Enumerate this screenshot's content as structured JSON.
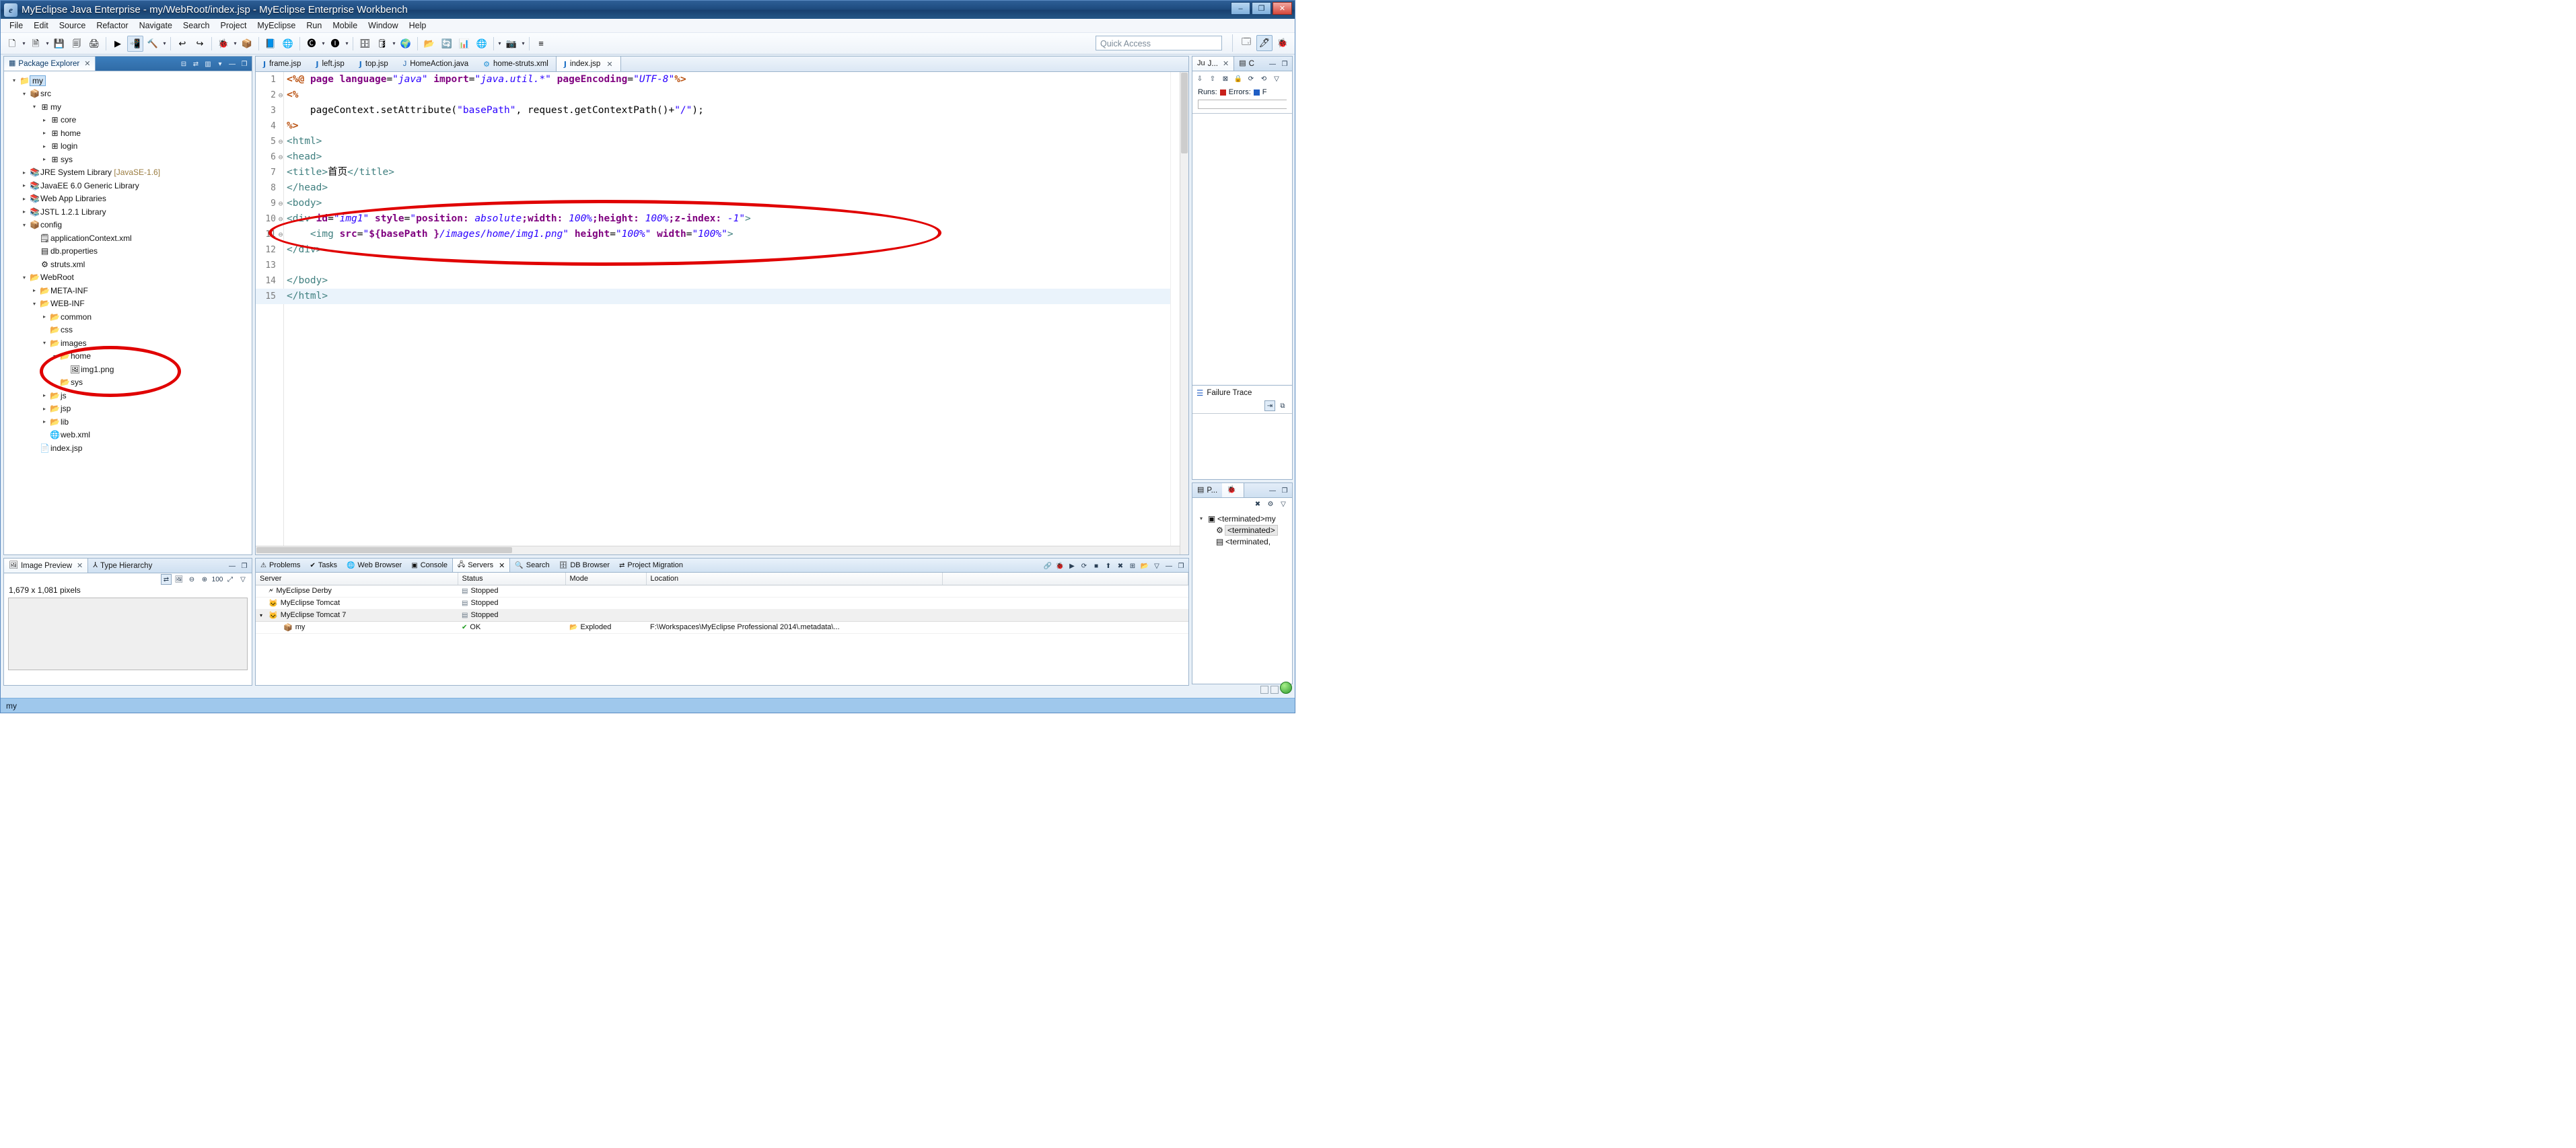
{
  "window": {
    "title": "MyEclipse Java Enterprise - my/WebRoot/index.jsp - MyEclipse Enterprise Workbench",
    "app_icon": "myeclipse-icon",
    "minimize": "–",
    "maximize": "❐",
    "close": "✕"
  },
  "menubar": [
    {
      "label": "File"
    },
    {
      "label": "Edit"
    },
    {
      "label": "Source"
    },
    {
      "label": "Refactor"
    },
    {
      "label": "Navigate"
    },
    {
      "label": "Search"
    },
    {
      "label": "Project"
    },
    {
      "label": "MyEclipse"
    },
    {
      "label": "Run"
    },
    {
      "label": "Mobile"
    },
    {
      "label": "Window"
    },
    {
      "label": "Help"
    }
  ],
  "toolbar": {
    "quick_access_placeholder": "Quick Access",
    "items": [
      {
        "name": "new-wizard",
        "glyph": "🗋"
      },
      {
        "name": "dropdown-arrow",
        "glyph": "▾"
      },
      {
        "name": "new-java-project",
        "glyph": "🗎"
      },
      {
        "name": "dropdown-arrow",
        "glyph": "▾"
      },
      {
        "name": "save",
        "glyph": "💾"
      },
      {
        "name": "save-all",
        "glyph": "🗐"
      },
      {
        "name": "print",
        "glyph": "🖨"
      },
      {
        "name": "run-server",
        "glyph": "▶"
      },
      {
        "name": "deploy-myeclipse",
        "glyph": "📲"
      },
      {
        "name": "build",
        "glyph": "🔨"
      },
      {
        "name": "dropdown-arrow",
        "glyph": "▾"
      },
      {
        "name": "undo",
        "glyph": "↩"
      },
      {
        "name": "redo",
        "glyph": "↪"
      },
      {
        "name": "debug",
        "glyph": "🐞"
      },
      {
        "name": "dropdown-arrow",
        "glyph": "▾"
      },
      {
        "name": "open-type",
        "glyph": "📦"
      },
      {
        "name": "open-resource",
        "glyph": "📘"
      },
      {
        "name": "web-20",
        "glyph": "🌐"
      },
      {
        "name": "new-class",
        "glyph": "🅒"
      },
      {
        "name": "dropdown-arrow",
        "glyph": "▾"
      },
      {
        "name": "new-interface",
        "glyph": "🅘"
      },
      {
        "name": "dropdown-arrow",
        "glyph": "▾"
      },
      {
        "name": "db-explorer",
        "glyph": "🗄"
      },
      {
        "name": "run-db",
        "glyph": "🛢"
      },
      {
        "name": "dropdown-arrow",
        "glyph": "▾"
      },
      {
        "name": "globe",
        "glyph": "🌍"
      },
      {
        "name": "open-folder",
        "glyph": "📂"
      },
      {
        "name": "refresh",
        "glyph": "🔄"
      },
      {
        "name": "report",
        "glyph": "📊"
      },
      {
        "name": "web-browser",
        "glyph": "🌐"
      },
      {
        "name": "dropdown-arrow",
        "glyph": "▾"
      },
      {
        "name": "snapshot",
        "glyph": "📷"
      },
      {
        "name": "dropdown-arrow",
        "glyph": "▾"
      },
      {
        "name": "toggle-marks",
        "glyph": "≡"
      }
    ],
    "perspective": [
      {
        "name": "open-perspective",
        "glyph": "🗔",
        "active": false
      },
      {
        "name": "myeclipse-java-enterprise-perspective",
        "glyph": "🖊",
        "active": true
      },
      {
        "name": "debug-perspective",
        "glyph": "🐞",
        "active": false
      }
    ]
  },
  "package_explorer": {
    "tabs": [
      {
        "label": "Package Explorer",
        "icon": "package-explorer-icon",
        "active": true,
        "closable": true
      }
    ],
    "toolbar": [
      {
        "name": "collapse-all-icon",
        "glyph": "⊟"
      },
      {
        "name": "link-with-editor-icon",
        "glyph": "⇄"
      },
      {
        "name": "view-menu-filter-icon",
        "glyph": "▥"
      },
      {
        "name": "view-menu-icon",
        "glyph": "▾"
      },
      {
        "name": "minimize-icon",
        "glyph": "—"
      },
      {
        "name": "maximize-icon",
        "glyph": "❐"
      }
    ],
    "tree": [
      {
        "indent": 0,
        "twisty": "▾",
        "icon": "project-icon",
        "glyph": "📁",
        "label": "my",
        "selected": true
      },
      {
        "indent": 1,
        "twisty": "▾",
        "icon": "source-folder-icon",
        "glyph": "📦",
        "label": "src"
      },
      {
        "indent": 2,
        "twisty": "▾",
        "icon": "package-icon",
        "glyph": "⊞",
        "label": "my"
      },
      {
        "indent": 3,
        "twisty": "▸",
        "icon": "package-error-icon",
        "glyph": "⊞",
        "label": "core"
      },
      {
        "indent": 3,
        "twisty": "▸",
        "icon": "package-warning-icon",
        "glyph": "⊞",
        "label": "home"
      },
      {
        "indent": 3,
        "twisty": "▸",
        "icon": "package-warning-icon",
        "glyph": "⊞",
        "label": "login"
      },
      {
        "indent": 3,
        "twisty": "▸",
        "icon": "package-warning-icon",
        "glyph": "⊞",
        "label": "sys"
      },
      {
        "indent": 1,
        "twisty": "▸",
        "icon": "library-icon",
        "glyph": "📚",
        "label": "JRE System Library",
        "dim": " [JavaSE-1.6]"
      },
      {
        "indent": 1,
        "twisty": "▸",
        "icon": "library-icon",
        "glyph": "📚",
        "label": "JavaEE 6.0 Generic Library"
      },
      {
        "indent": 1,
        "twisty": "▸",
        "icon": "library-icon",
        "glyph": "📚",
        "label": "Web App Libraries"
      },
      {
        "indent": 1,
        "twisty": "▸",
        "icon": "library-icon",
        "glyph": "📚",
        "label": "JSTL 1.2.1 Library"
      },
      {
        "indent": 1,
        "twisty": "▾",
        "icon": "source-folder-icon",
        "glyph": "📦",
        "label": "config"
      },
      {
        "indent": 2,
        "twisty": "",
        "icon": "xml-file-icon",
        "glyph": "🗒",
        "label": "applicationContext.xml"
      },
      {
        "indent": 2,
        "twisty": "",
        "icon": "properties-file-icon",
        "glyph": "▤",
        "label": "db.properties"
      },
      {
        "indent": 2,
        "twisty": "",
        "icon": "struts-config-icon",
        "glyph": "⚙",
        "label": "struts.xml"
      },
      {
        "indent": 1,
        "twisty": "▾",
        "icon": "webroot-folder-icon",
        "glyph": "📂",
        "label": "WebRoot"
      },
      {
        "indent": 2,
        "twisty": "▸",
        "icon": "folder-icon",
        "glyph": "📂",
        "label": "META-INF"
      },
      {
        "indent": 2,
        "twisty": "▾",
        "icon": "folder-warning-icon",
        "glyph": "📂",
        "label": "WEB-INF"
      },
      {
        "indent": 3,
        "twisty": "▸",
        "icon": "folder-icon",
        "glyph": "📂",
        "label": "common"
      },
      {
        "indent": 3,
        "twisty": "",
        "icon": "folder-icon",
        "glyph": "📂",
        "label": "css"
      },
      {
        "indent": 3,
        "twisty": "▾",
        "icon": "folder-icon",
        "glyph": "📂",
        "label": "images"
      },
      {
        "indent": 4,
        "twisty": "▾",
        "icon": "folder-icon",
        "glyph": "📂",
        "label": "home"
      },
      {
        "indent": 5,
        "twisty": "",
        "icon": "image-file-icon",
        "glyph": "🖼",
        "label": "img1.png"
      },
      {
        "indent": 4,
        "twisty": "",
        "icon": "folder-icon",
        "glyph": "📂",
        "label": "sys"
      },
      {
        "indent": 3,
        "twisty": "▸",
        "icon": "folder-warning-icon",
        "glyph": "📂",
        "label": "js"
      },
      {
        "indent": 3,
        "twisty": "▸",
        "icon": "folder-warning-icon",
        "glyph": "📂",
        "label": "jsp"
      },
      {
        "indent": 3,
        "twisty": "▸",
        "icon": "folder-icon",
        "glyph": "📂",
        "label": "lib"
      },
      {
        "indent": 3,
        "twisty": "",
        "icon": "web-xml-icon",
        "glyph": "🌐",
        "label": "web.xml"
      },
      {
        "indent": 2,
        "twisty": "",
        "icon": "jsp-file-icon",
        "glyph": "📄",
        "label": "index.jsp"
      }
    ]
  },
  "image_preview": {
    "tabs": [
      {
        "label": "Image Preview",
        "icon": "image-preview-icon",
        "active": true,
        "closable": true
      },
      {
        "label": "Type Hierarchy",
        "icon": "type-hierarchy-icon",
        "active": false,
        "closable": false
      }
    ],
    "view_buttons": [
      {
        "name": "minimize-icon",
        "glyph": "—"
      },
      {
        "name": "maximize-icon",
        "glyph": "❐"
      }
    ],
    "toolbar": [
      {
        "name": "link-with-editor-icon",
        "glyph": "⇄",
        "framed": true
      },
      {
        "name": "image-properties-icon",
        "glyph": "🖼"
      },
      {
        "name": "zoom-out-icon",
        "glyph": "⊖"
      },
      {
        "name": "zoom-in-icon",
        "glyph": "⊕"
      },
      {
        "name": "zoom-100-icon",
        "glyph": "100"
      },
      {
        "name": "fit-to-window-icon",
        "glyph": "⤢"
      },
      {
        "name": "view-menu-icon",
        "glyph": "▽"
      }
    ],
    "size_label": "1,679 x 1,081 pixels"
  },
  "editor": {
    "tabs": [
      {
        "label": "frame.jsp",
        "icon": "jsp-file-icon",
        "active": false
      },
      {
        "label": "left.jsp",
        "icon": "jsp-file-icon",
        "active": false
      },
      {
        "label": "top.jsp",
        "icon": "jsp-file-icon",
        "active": false
      },
      {
        "label": "HomeAction.java",
        "icon": "java-file-icon",
        "active": false
      },
      {
        "label": "home-struts.xml",
        "icon": "struts-config-icon",
        "active": false
      },
      {
        "label": "index.jsp",
        "icon": "jsp-file-icon",
        "active": true,
        "closable": true
      }
    ],
    "lines": [
      {
        "n": "1",
        "fold": "",
        "text": "<%@ page language=\"java\" import=\"java.util.*\" pageEncoding=\"UTF-8\"%>"
      },
      {
        "n": "2",
        "fold": "⊖",
        "text": "<%"
      },
      {
        "n": "3",
        "fold": "",
        "text": "    pageContext.setAttribute(\"basePath\", request.getContextPath()+\"/\");"
      },
      {
        "n": "4",
        "fold": "",
        "text": "%>"
      },
      {
        "n": "5",
        "fold": "⊖",
        "text": "<html>"
      },
      {
        "n": "6",
        "fold": "⊖",
        "text": "<head>"
      },
      {
        "n": "7",
        "fold": "",
        "text": "<title>首页</title>"
      },
      {
        "n": "8",
        "fold": "",
        "text": "</head>"
      },
      {
        "n": "9",
        "fold": "⊖",
        "text": "<body>"
      },
      {
        "n": "10",
        "fold": "⊖",
        "text": "<div id=\"img1\" style=\"position: absolute;width: 100%;height: 100%;z-index: -1\">"
      },
      {
        "n": "11",
        "fold": "⊖",
        "text": "    <img src=\"${basePath }/images/home/img1.png\" height=\"100%\" width=\"100%\">"
      },
      {
        "n": "12",
        "fold": "",
        "text": "</div>"
      },
      {
        "n": "13",
        "fold": "",
        "text": ""
      },
      {
        "n": "14",
        "fold": "",
        "text": "</body>"
      },
      {
        "n": "15",
        "fold": "",
        "text": "</html>",
        "highlight": true
      }
    ]
  },
  "junit_view": {
    "tabs": [
      {
        "label": "J...",
        "icon": "junit-icon",
        "active": true,
        "closable": true
      },
      {
        "label": "C",
        "icon": "outline-icon",
        "active": false
      }
    ],
    "view_buttons": [
      {
        "name": "minimize-icon",
        "glyph": "—"
      },
      {
        "name": "maximize-icon",
        "glyph": "❐"
      }
    ],
    "toolbar": [
      {
        "name": "next-failure-icon",
        "glyph": "⇩"
      },
      {
        "name": "previous-failure-icon",
        "glyph": "⇧"
      },
      {
        "name": "show-failures-only-icon",
        "glyph": "⊠"
      },
      {
        "name": "scroll-lock-icon",
        "glyph": "🔒"
      },
      {
        "name": "rerun-test-icon",
        "glyph": "⟳"
      },
      {
        "name": "rerun-failed-icon",
        "glyph": "⟲"
      },
      {
        "name": "view-menu-icon",
        "glyph": "▽"
      }
    ],
    "counters": {
      "runs_label": "Runs:",
      "errors_label": "Errors:",
      "failures_label": "F",
      "errors_color": "#c8201a",
      "failures_color": "#1f5ec4"
    },
    "failure_trace": {
      "title": "Failure Trace",
      "icon": "failure-trace-icon",
      "tools": [
        {
          "name": "filter-stack-trace-icon",
          "glyph": "⇥",
          "framed": true
        },
        {
          "name": "compare-result-icon",
          "glyph": "⧉"
        }
      ]
    }
  },
  "console_view": {
    "tabs": [
      {
        "label": "P...",
        "icon": "properties-icon",
        "active": false
      },
      {
        "label": "",
        "icon": "debug-console-icon",
        "active": true
      }
    ],
    "view_buttons": [
      {
        "name": "minimize-icon",
        "glyph": "—"
      },
      {
        "name": "maximize-icon",
        "glyph": "❐"
      }
    ],
    "toolbar": [
      {
        "name": "remove-all-terminated-icon",
        "glyph": "✖"
      },
      {
        "name": "debug-view-icon",
        "glyph": "⚙"
      },
      {
        "name": "view-menu-icon",
        "glyph": "▽"
      }
    ],
    "tree": [
      {
        "indent": 0,
        "twisty": "▾",
        "icon": "launch-config-icon",
        "glyph": "▣",
        "label": "<terminated>my"
      },
      {
        "indent": 1,
        "twisty": "",
        "icon": "process-icon",
        "glyph": "⚙",
        "label": "<terminated>",
        "selected": true
      },
      {
        "indent": 1,
        "twisty": "",
        "icon": "process-error-icon",
        "glyph": "▤",
        "label": "<terminated,"
      }
    ]
  },
  "servers_view": {
    "tabs": [
      {
        "label": "Problems",
        "icon": "problems-icon",
        "active": false
      },
      {
        "label": "Tasks",
        "icon": "tasks-icon",
        "active": false
      },
      {
        "label": "Web Browser",
        "icon": "web-browser-icon",
        "active": false
      },
      {
        "label": "Console",
        "icon": "console-icon",
        "active": false
      },
      {
        "label": "Servers",
        "icon": "servers-icon",
        "active": true,
        "closable": true
      },
      {
        "label": "Search",
        "icon": "search-icon",
        "active": false
      },
      {
        "label": "DB Browser",
        "icon": "db-browser-icon",
        "active": false
      },
      {
        "label": "Project Migration",
        "icon": "project-migration-icon",
        "active": false
      }
    ],
    "toolbar": [
      {
        "name": "link-icon",
        "glyph": "🔗"
      },
      {
        "name": "debug-server-icon",
        "glyph": "🐞"
      },
      {
        "name": "start-server-icon",
        "glyph": "▶"
      },
      {
        "name": "restart-server-icon",
        "glyph": "⟳"
      },
      {
        "name": "stop-server-icon",
        "glyph": "■"
      },
      {
        "name": "publish-icon",
        "glyph": "⬆"
      },
      {
        "name": "remove-module-icon",
        "glyph": "✖"
      },
      {
        "name": "add-module-icon",
        "glyph": "⊞"
      },
      {
        "name": "open-folder-icon",
        "glyph": "📂"
      },
      {
        "name": "view-menu-icon",
        "glyph": "▽"
      },
      {
        "name": "minimize-icon",
        "glyph": "—"
      },
      {
        "name": "maximize-icon",
        "glyph": "❐"
      }
    ],
    "columns": [
      "Server",
      "Status",
      "Mode",
      "Location"
    ],
    "rows": [
      {
        "indent": 0,
        "twisty": "",
        "icon": "derby-server-icon",
        "glyph": "🗲",
        "server": "MyEclipse Derby",
        "status_icon": "stopped-icon",
        "status": "Stopped",
        "mode_icon": "",
        "mode": "",
        "location": ""
      },
      {
        "indent": 0,
        "twisty": "",
        "icon": "tomcat-server-icon",
        "glyph": "🐱",
        "server": "MyEclipse Tomcat",
        "status_icon": "stopped-icon",
        "status": "Stopped",
        "mode_icon": "",
        "mode": "",
        "location": ""
      },
      {
        "indent": 0,
        "twisty": "▾",
        "icon": "tomcat-server-icon",
        "glyph": "🐱",
        "server": "MyEclipse Tomcat 7",
        "status_icon": "stopped-icon",
        "status": "Stopped",
        "mode_icon": "",
        "mode": "",
        "location": "",
        "selected": true
      },
      {
        "indent": 1,
        "twisty": "",
        "icon": "deployed-module-icon",
        "glyph": "📦",
        "server": "my",
        "status_icon": "ok-icon",
        "status": "OK",
        "mode_icon": "exploded-icon",
        "mode": "Exploded",
        "location": "F:\\Workspaces\\MyEclipse Professional 2014\\.metadata\\..."
      }
    ]
  },
  "statusbar": {
    "text": "my"
  },
  "annotations": [
    {
      "name": "code-highlight-ellipse",
      "color": "#e00000",
      "target": "div img1 code lines 10-11"
    },
    {
      "name": "tree-highlight-ellipse",
      "color": "#e00000",
      "target": "images/home/img1.png tree node"
    }
  ]
}
